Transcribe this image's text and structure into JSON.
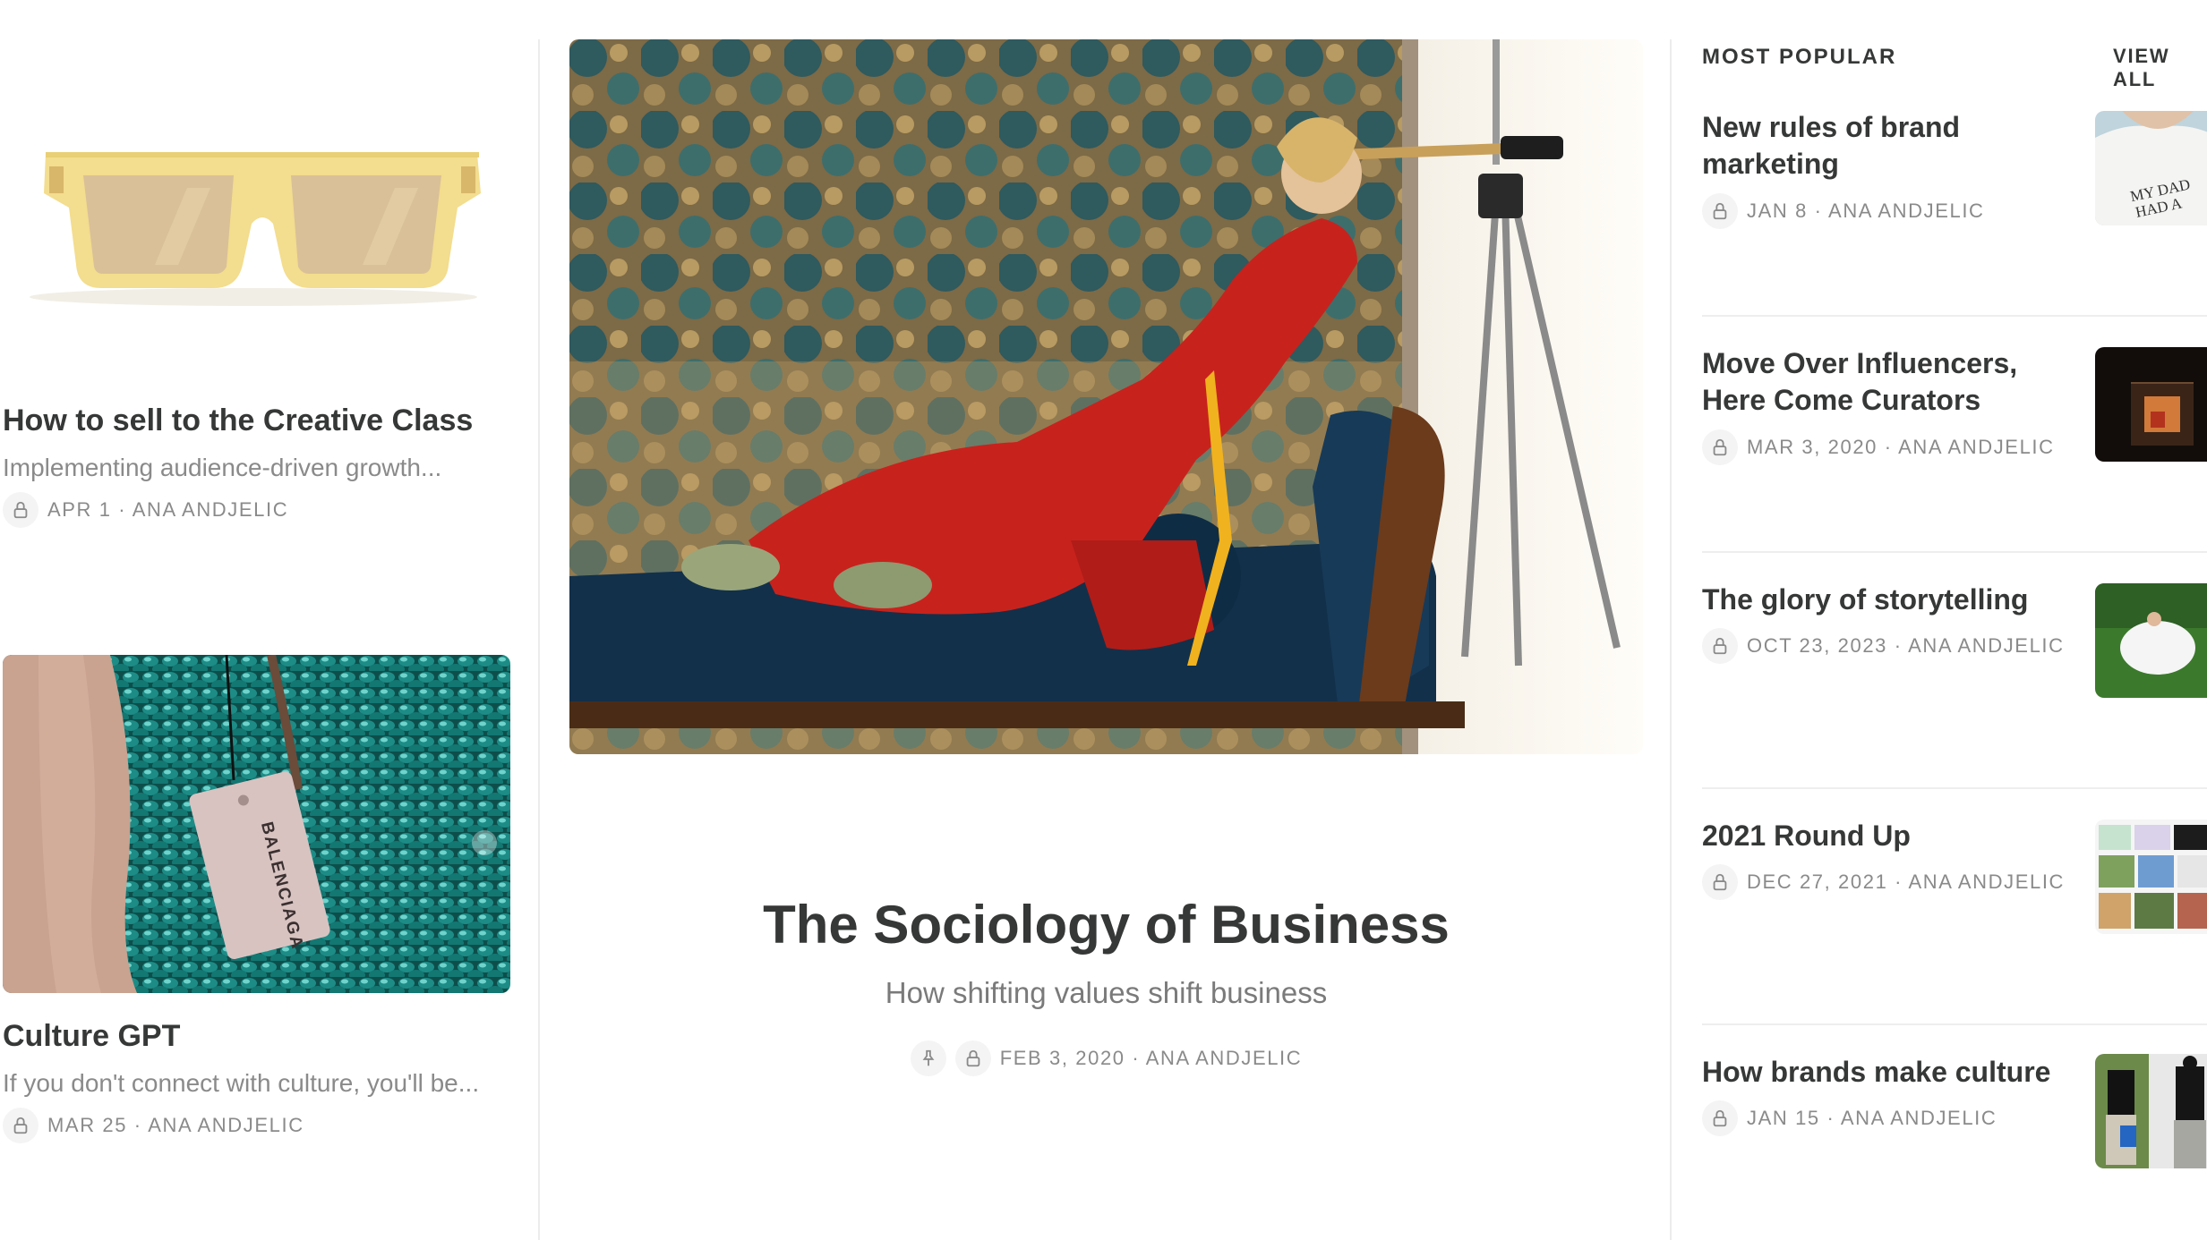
{
  "left_posts": [
    {
      "title": "How to sell to the Creative Class",
      "subtitle": "Implementing audience-driven growth...",
      "meta": "APR 1 · ANA ANDJELIC",
      "image": "yellow-sunglasses"
    },
    {
      "title": "Culture GPT",
      "subtitle": "If you don't connect with culture, you'll be...",
      "meta": "MAR 25 · ANA ANDJELIC",
      "image": "balenciaga-sequin-tag",
      "image_text": "BALENCIAGA"
    }
  ],
  "featured": {
    "title": "The Sociology of Business",
    "subtitle": "How shifting values shift business",
    "meta": "FEB 3, 2020 · ANA ANDJELIC",
    "icons": [
      "pin-icon",
      "lock-icon"
    ]
  },
  "most_popular": {
    "heading": "MOST POPULAR",
    "view_all": "VIEW ALL",
    "items": [
      {
        "title": "New rules of brand marketing",
        "meta": "JAN 8 · ANA ANDJELIC",
        "image_text": "MY DAD HAD A ROLLS"
      },
      {
        "title": "Move Over Influencers, Here Come Curators",
        "meta": "MAR 3, 2020 · ANA ANDJELIC"
      },
      {
        "title": "The glory of storytelling",
        "meta": "OCT 23, 2023 · ANA ANDJELIC"
      },
      {
        "title": "2021 Round Up",
        "meta": "DEC 27, 2021 · ANA ANDJELIC"
      },
      {
        "title": "How brands make culture",
        "meta": "JAN 15 · ANA ANDJELIC"
      }
    ]
  },
  "colors": {
    "text": "#363737",
    "muted": "#8a8a8a",
    "divider": "#ececec",
    "jumpsuit_red": "#c8221d"
  }
}
